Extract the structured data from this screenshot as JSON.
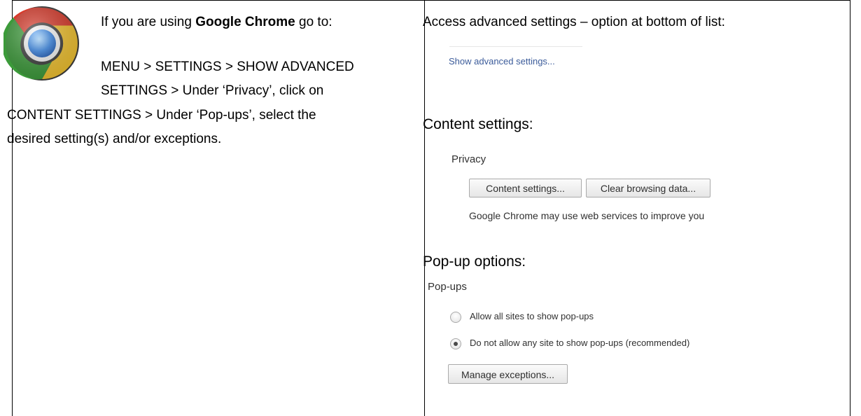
{
  "left_cell": {
    "logo_icon": "google-chrome-logo",
    "line1_prefix": "If you are using ",
    "line1_bold": "Google Chrome",
    "line1_suffix": " go to:",
    "line2": "MENU > SETTINGS > SHOW ADVANCED",
    "line3": "SETTINGS > Under ‘Privacy’, click on",
    "line4": "CONTENT SETTINGS > Under ‘Pop-ups’, select the",
    "line5": "desired setting(s) and/or exceptions."
  },
  "right_cell": {
    "heading_advanced": "Access advanced settings – option at bottom of list:",
    "advanced_link": "Show advanced settings...",
    "heading_content": "Content settings:",
    "privacy_label": "Privacy",
    "content_settings_button": "Content settings...",
    "clear_browsing_button": "Clear browsing data...",
    "chrome_note": "Google Chrome may use web services to improve you",
    "heading_popup": "Pop-up options:",
    "popups_label": "Pop-ups",
    "radio_options": [
      {
        "label": "Allow all sites to show pop-ups",
        "checked": false
      },
      {
        "label": "Do not allow any site to show pop-ups (recommended)",
        "checked": true
      }
    ],
    "manage_exceptions_button": "Manage exceptions..."
  }
}
